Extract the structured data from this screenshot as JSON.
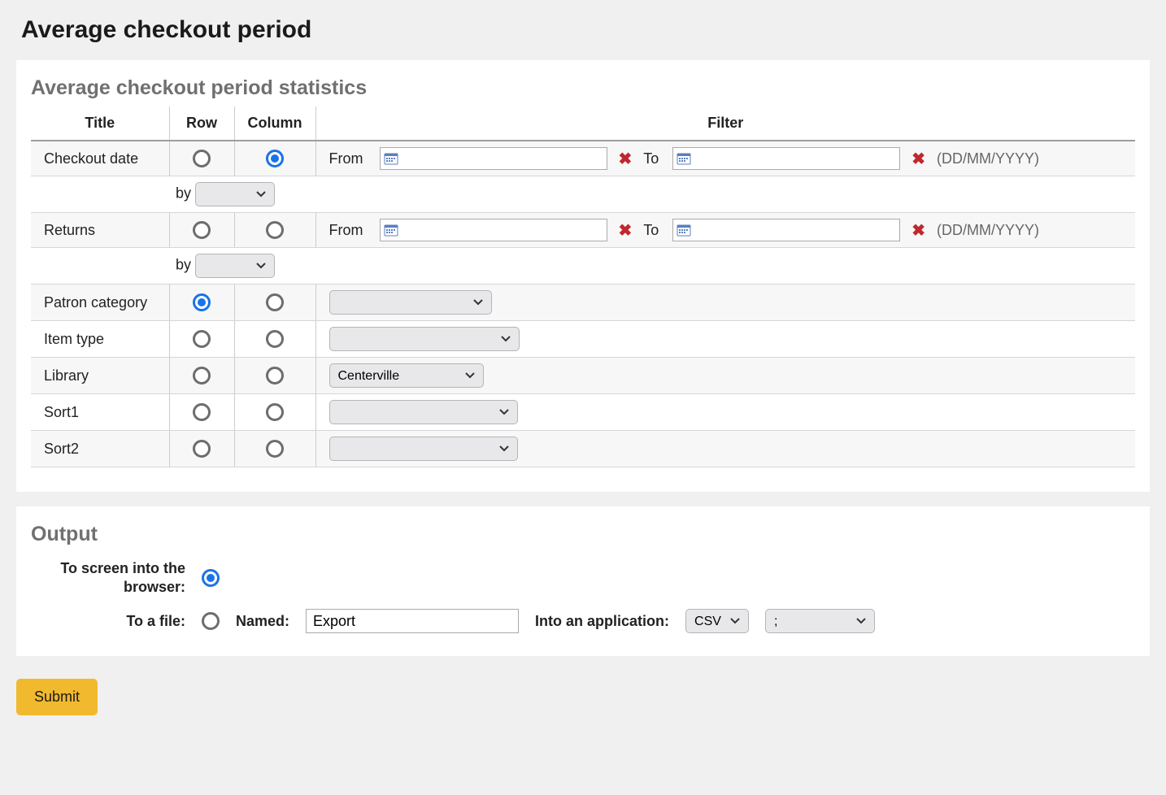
{
  "page_title": "Average checkout period",
  "stats": {
    "legend": "Average checkout period statistics",
    "headers": {
      "title": "Title",
      "row": "Row",
      "column": "Column",
      "filter": "Filter"
    },
    "date_labels": {
      "from": "From",
      "to": "To",
      "hint": "(DD/MM/YYYY)"
    },
    "by_label": "by",
    "rows": {
      "checkout_date": "Checkout date",
      "returns": "Returns",
      "patron_category": "Patron category",
      "item_type": "Item type",
      "library": "Library",
      "sort1": "Sort1",
      "sort2": "Sort2"
    },
    "library_selected": "Centerville"
  },
  "output": {
    "legend": "Output",
    "to_screen_label": "To screen into the browser:",
    "to_file_label": "To a file:",
    "named_label": "Named:",
    "named_value": "Export",
    "into_label": "Into an application:",
    "format_selected": "CSV",
    "separator_selected": ";"
  },
  "submit_label": "Submit"
}
